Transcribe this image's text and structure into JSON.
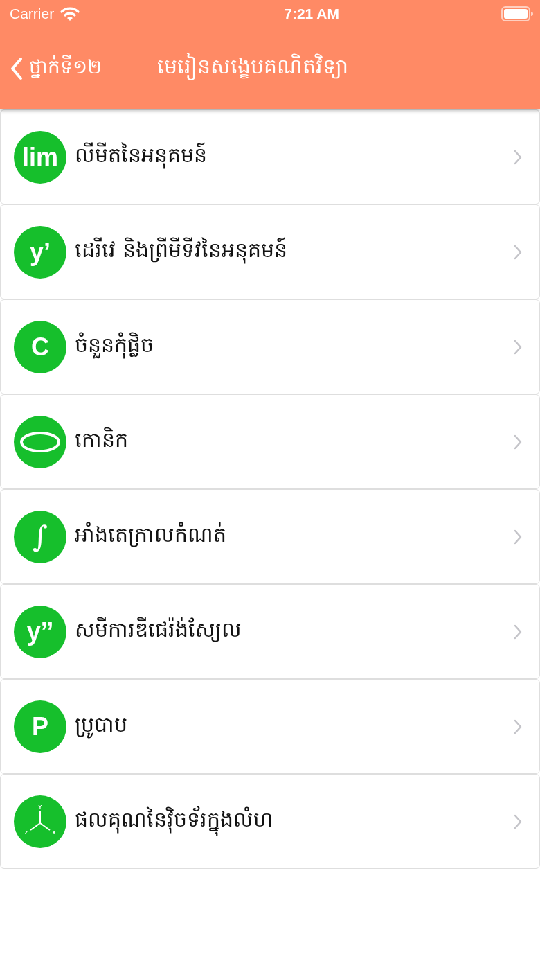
{
  "status_bar": {
    "carrier": "Carrier",
    "time": "7:21 AM"
  },
  "nav": {
    "back_label": "ថ្នាក់ទី១២",
    "title": "មេរៀនសង្ខេបគណិតវិទ្យា"
  },
  "lessons": [
    {
      "icon": {
        "kind": "text",
        "text": "lim"
      },
      "title": "លីមីតនៃអនុគមន៍"
    },
    {
      "icon": {
        "kind": "text",
        "text": "y’"
      },
      "title": "ដេរីវេ និងព្រីមីទីវនៃអនុគមន៍"
    },
    {
      "icon": {
        "kind": "text",
        "text": "C"
      },
      "title": "ចំនួនកុំផ្លិច"
    },
    {
      "icon": {
        "kind": "ellipse"
      },
      "title": "កោនិក"
    },
    {
      "icon": {
        "kind": "text",
        "text": "∫"
      },
      "title": "អាំងតេក្រាលកំណត់"
    },
    {
      "icon": {
        "kind": "text",
        "text": "y’’"
      },
      "title": "សមីការឌីផេរ៉ង់ស្យែល"
    },
    {
      "icon": {
        "kind": "text",
        "text": "P"
      },
      "title": "ប្រូបាប"
    },
    {
      "icon": {
        "kind": "axes",
        "labels": [
          "Y",
          "Z",
          "X"
        ]
      },
      "title": "ផលគុណនៃវ៉ិចទ័រក្នុងលំហ"
    }
  ]
}
